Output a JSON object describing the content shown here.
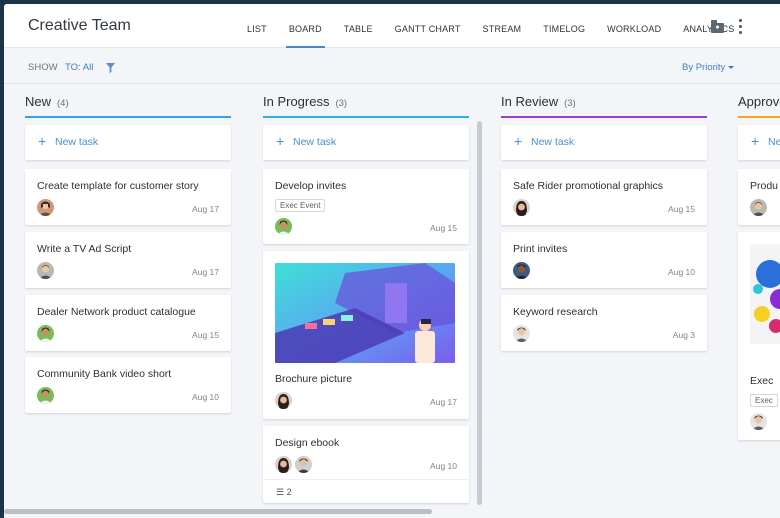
{
  "header": {
    "title": "Creative Team",
    "tabs": [
      {
        "label": "LIST"
      },
      {
        "label": "BOARD"
      },
      {
        "label": "TABLE"
      },
      {
        "label": "GANTT CHART"
      },
      {
        "label": "STREAM"
      },
      {
        "label": "TIMELOG"
      },
      {
        "label": "WORKLOAD"
      },
      {
        "label": "ANALYTICS"
      }
    ],
    "active_tab": "BOARD",
    "folder_icon": "folder-user-icon",
    "more_icon": "vertical-dots-icon"
  },
  "filterbar": {
    "show_label": "SHOW",
    "to_label": "TO: All",
    "filter_icon": "funnel-icon",
    "sort_label": "By Priority"
  },
  "colors": {
    "accent": "#4488c5",
    "new": "#2fa4e7",
    "in_progress": "#2bb3e0",
    "in_review": "#9b3fcf",
    "approved": "#f5a623"
  },
  "new_task_label": "New task",
  "columns": [
    {
      "title": "New",
      "count": "(4)",
      "tasks": [
        {
          "name": "Create template for customer story",
          "date": "Aug 17"
        },
        {
          "name": "Write a TV Ad Script",
          "date": "Aug 17"
        },
        {
          "name": "Dealer Network product catalogue",
          "date": "Aug 15"
        },
        {
          "name": "Community Bank video short",
          "date": "Aug 10"
        }
      ]
    },
    {
      "title": "In Progress",
      "count": "(3)",
      "tasks": [
        {
          "name": "Develop invites",
          "tag": "Exec Event",
          "date": "Aug 15"
        },
        {
          "name": "Brochure picture",
          "date": "Aug 17"
        },
        {
          "name": "Design ebook",
          "date": "Aug 10",
          "subtasks": "2"
        }
      ]
    },
    {
      "title": "In Review",
      "count": "(3)",
      "tasks": [
        {
          "name": "Safe Rider promotional graphics",
          "date": "Aug 15"
        },
        {
          "name": "Print invites",
          "date": "Aug 10"
        },
        {
          "name": "Keyword research",
          "date": "Aug 3"
        }
      ]
    },
    {
      "title": "Approved",
      "count": "",
      "tasks": [
        {
          "name": "Produ"
        },
        {
          "name": "Exec",
          "tag": "Exec"
        }
      ]
    }
  ]
}
